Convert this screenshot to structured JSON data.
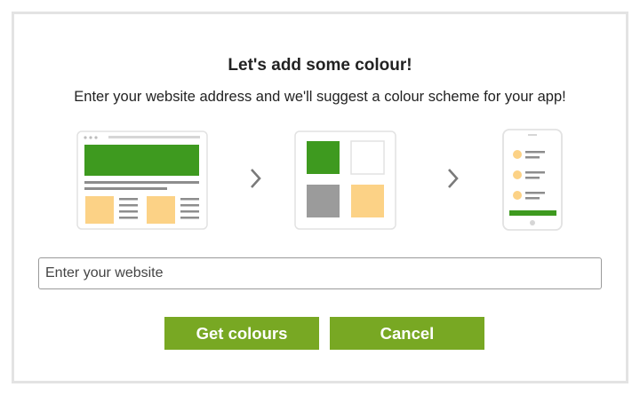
{
  "dialog": {
    "title": "Let's add some colour!",
    "subtitle": "Enter your website address and we'll suggest a colour scheme for your app!"
  },
  "illustrations": {
    "website_mockup": "website-mockup-icon",
    "palette": "colour-palette-icon",
    "phone": "phone-app-icon",
    "arrow": "chevron-right-icon"
  },
  "colors": {
    "green": "#3e9a1f",
    "peach": "#fcd286",
    "gray": "#9b9b9b",
    "button": "#78a823",
    "line": "#8d8d8d"
  },
  "input": {
    "placeholder": "Enter your website",
    "value": ""
  },
  "buttons": {
    "get_colours": "Get colours",
    "cancel": "Cancel"
  }
}
